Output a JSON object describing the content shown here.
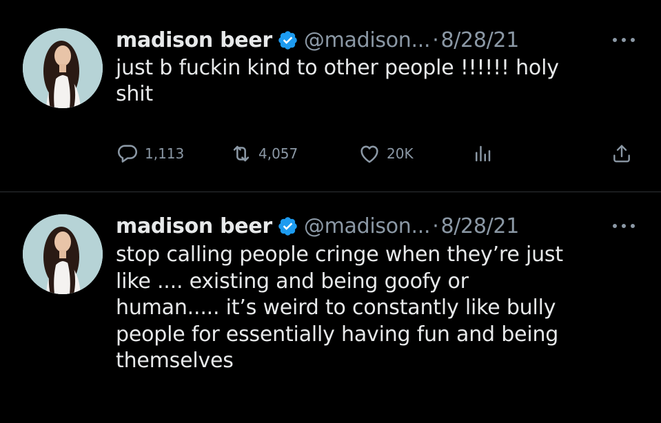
{
  "tweets": [
    {
      "author": {
        "name": "madison beer",
        "handle": "@madison...",
        "verified": true,
        "avatar": "profile-photo"
      },
      "date": "8/28/21",
      "separator": "·",
      "text_lines": [
        "just b fuckin kind to other people !!!!!! holy",
        "shit"
      ],
      "stats": {
        "replies": "1,113",
        "retweets": "4,057",
        "likes": "20K"
      },
      "icons": [
        "reply-icon",
        "retweet-icon",
        "like-icon",
        "views-icon",
        "share-icon",
        "more-icon"
      ]
    },
    {
      "author": {
        "name": "madison beer",
        "handle": "@madison...",
        "verified": true,
        "avatar": "profile-photo"
      },
      "date": "8/28/21",
      "separator": "·",
      "text_lines": [
        "stop calling people cringe when they’re just",
        "like .... existing and being goofy or",
        "human..... it’s weird to constantly like bully",
        "people for essentially having fun and being",
        "themselves"
      ]
    }
  ],
  "colors": {
    "background": "#000000",
    "text": "#e7e9ea",
    "secondary": "#8b98a5",
    "verified_badge": "#1d9bf0",
    "divider": "#2f3336"
  }
}
